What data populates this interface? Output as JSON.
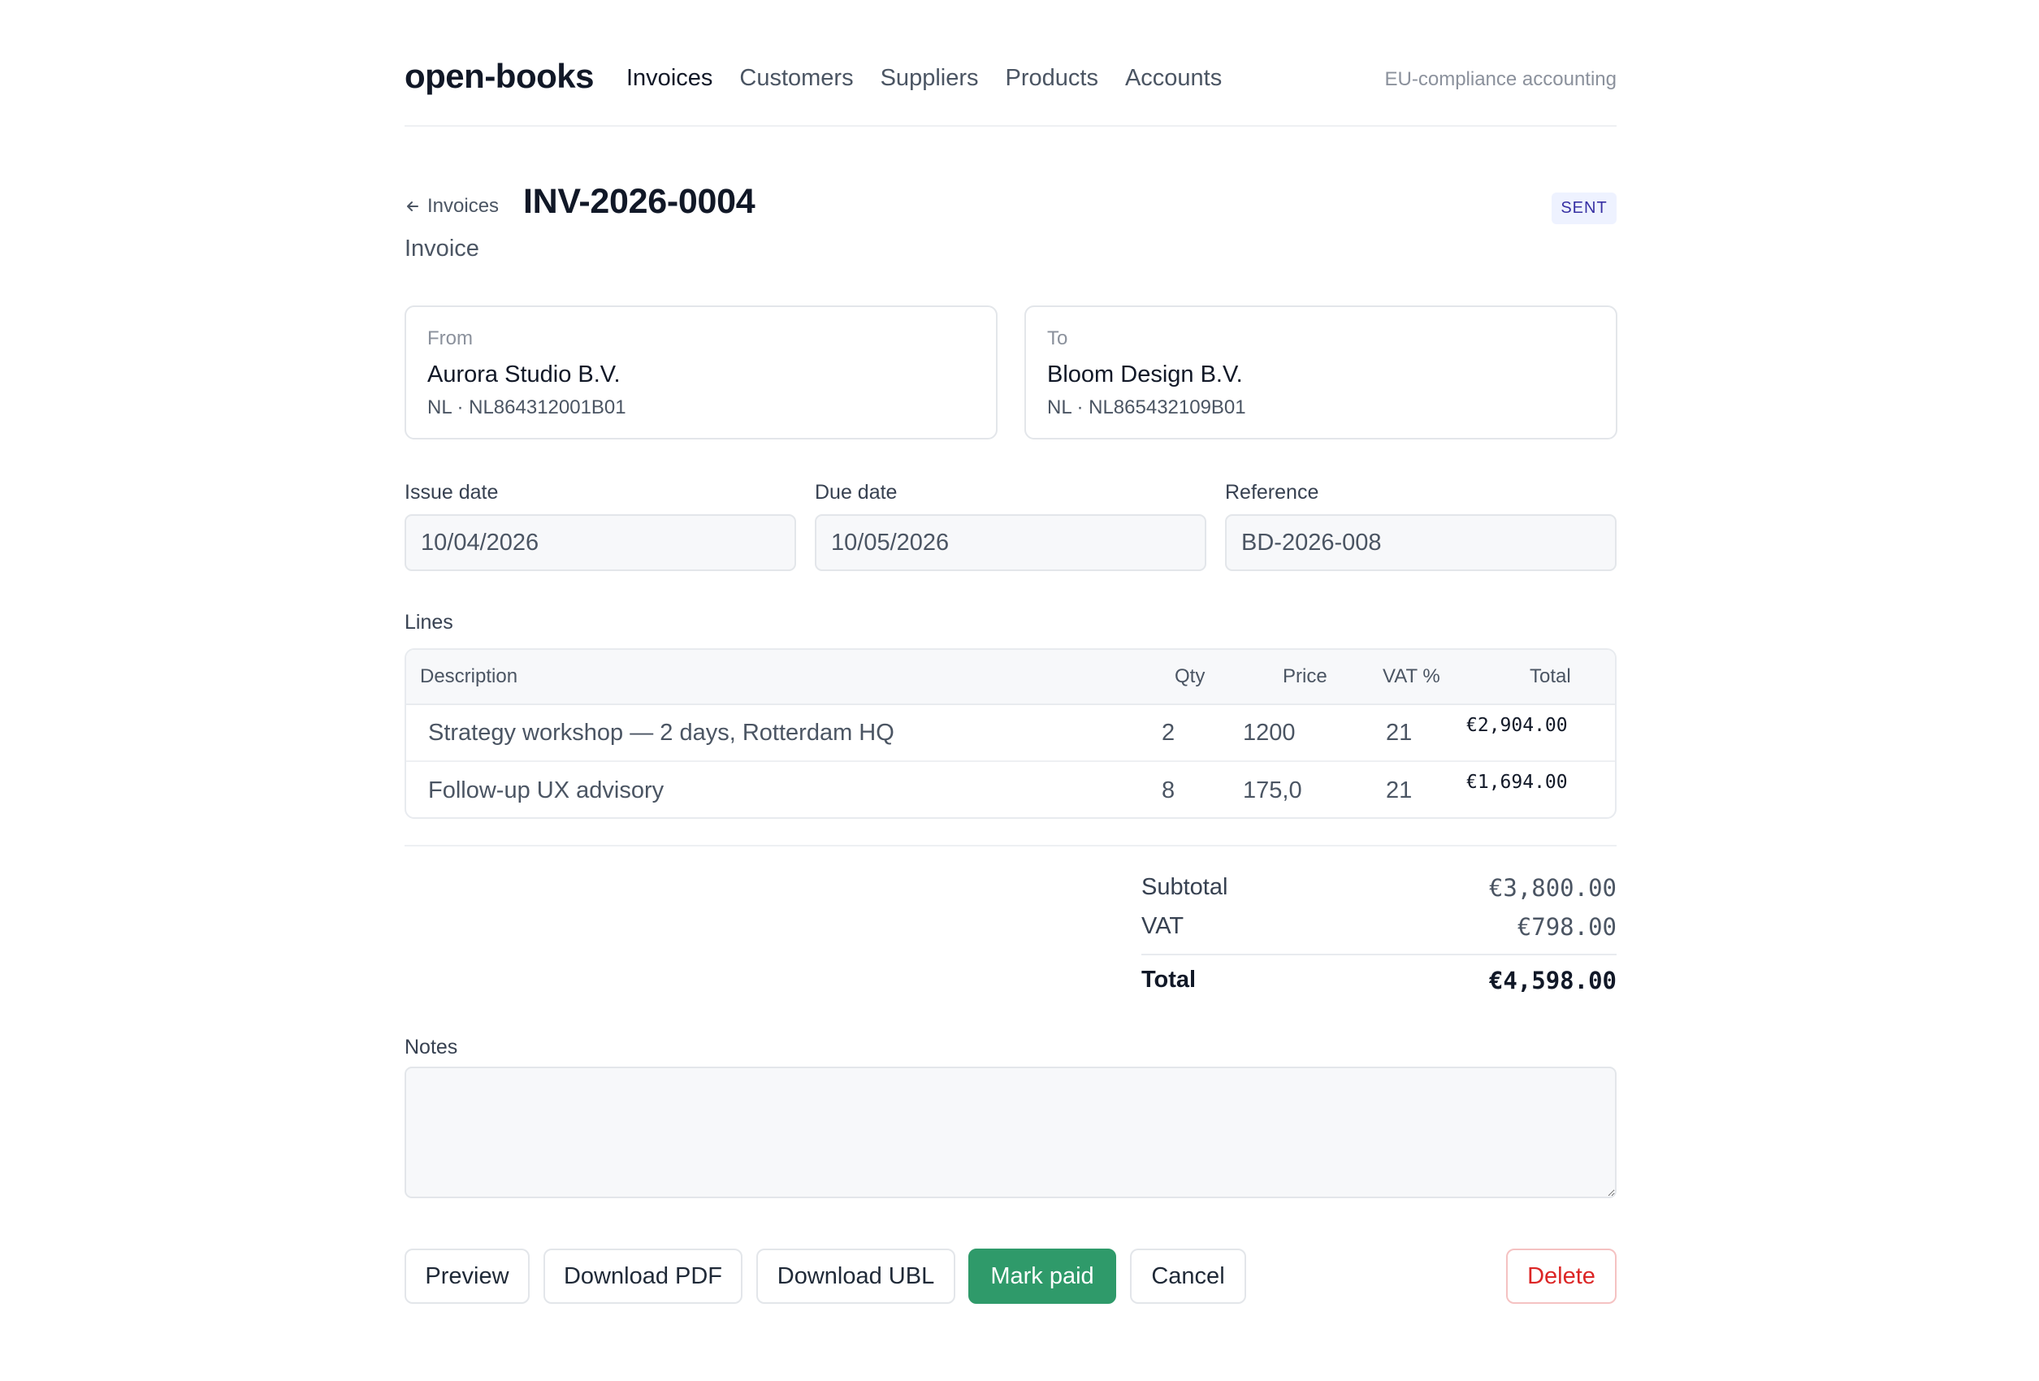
{
  "header": {
    "logo": "open-books",
    "nav": [
      {
        "label": "Invoices",
        "active": true
      },
      {
        "label": "Customers",
        "active": false
      },
      {
        "label": "Suppliers",
        "active": false
      },
      {
        "label": "Products",
        "active": false
      },
      {
        "label": "Accounts",
        "active": false
      }
    ],
    "tagline": "EU-compliance accounting"
  },
  "title": {
    "back_label": "Invoices",
    "back_icon": "arrow-left-icon",
    "invoice_number": "INV-2026-0004",
    "subtitle": "Invoice",
    "status": "SENT"
  },
  "parties": {
    "from": {
      "label": "From",
      "name": "Aurora Studio B.V.",
      "vat": "NL · NL864312001B01"
    },
    "to": {
      "label": "To",
      "name": "Bloom Design B.V.",
      "vat": "NL · NL865432109B01"
    }
  },
  "fields": {
    "issue_date": {
      "label": "Issue date",
      "value": "10/04/2026"
    },
    "due_date": {
      "label": "Due date",
      "value": "10/05/2026"
    },
    "reference": {
      "label": "Reference",
      "value": "BD-2026-008"
    }
  },
  "lines": {
    "label": "Lines",
    "columns": {
      "description": "Description",
      "qty": "Qty",
      "price": "Price",
      "vat": "VAT %",
      "total": "Total"
    },
    "rows": [
      {
        "description": "Strategy workshop — 2 days, Rotterdam HQ",
        "qty": "2",
        "price": "1200",
        "vat": "21",
        "total": "€2,904.00"
      },
      {
        "description": "Follow-up UX advisory",
        "qty": "8",
        "price": "175,0",
        "vat": "21",
        "total": "€1,694.00"
      }
    ]
  },
  "totals": {
    "subtotal_label": "Subtotal",
    "subtotal": "€3,800.00",
    "vat_label": "VAT",
    "vat": "€798.00",
    "total_label": "Total",
    "total": "€4,598.00"
  },
  "notes": {
    "label": "Notes",
    "value": ""
  },
  "actions": {
    "preview": "Preview",
    "download_pdf": "Download PDF",
    "download_ubl": "Download UBL",
    "mark_paid": "Mark paid",
    "cancel": "Cancel",
    "delete": "Delete"
  },
  "colors": {
    "primary": "#2f9a6a",
    "danger": "#dc2626",
    "badge_bg": "#eef2ff",
    "badge_text": "#3730a3"
  }
}
